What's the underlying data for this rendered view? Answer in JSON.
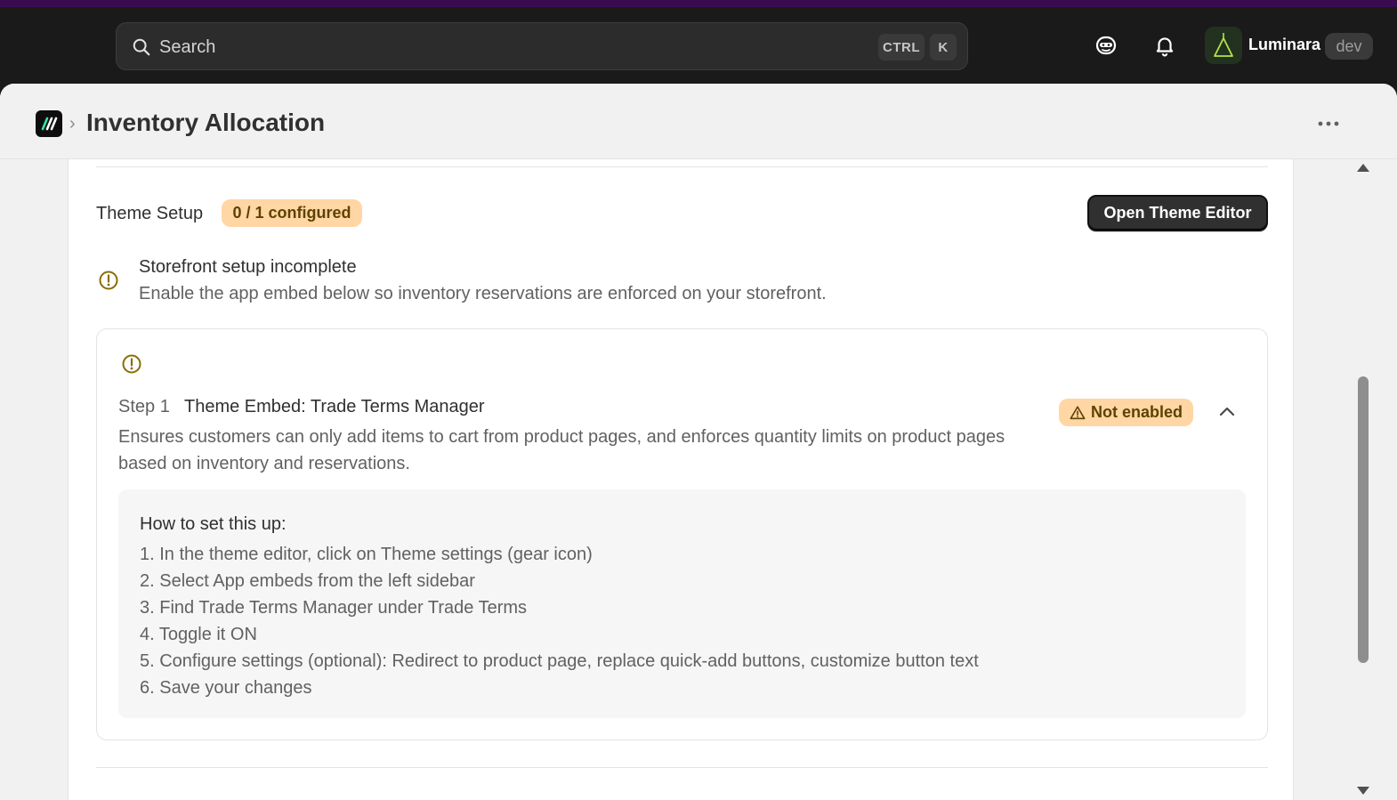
{
  "topbar": {
    "search_placeholder": "Search",
    "shortcut_ctrl": "CTRL",
    "shortcut_k": "K",
    "store_name": "Luminara",
    "store_badge": "dev"
  },
  "page": {
    "title": "Inventory Allocation"
  },
  "theme_setup": {
    "title": "Theme Setup",
    "count_badge": "0 / 1 configured",
    "open_button": "Open Theme Editor",
    "alert_title": "Storefront setup incomplete",
    "alert_desc": "Enable the app embed below so inventory reservations are enforced on your storefront."
  },
  "step": {
    "label": "Step 1",
    "title": "Theme Embed: Trade Terms Manager",
    "description": "Ensures customers can only add items to cart from product pages, and enforces quantity limits on product pages based on inventory and reservations.",
    "status": "Not enabled",
    "howto_title": "How to set this up:",
    "howto_steps": [
      "1. In the theme editor, click on Theme settings (gear icon)",
      "2. Select App embeds from the left sidebar",
      "3. Find Trade Terms Manager under Trade Terms",
      "4. Toggle it ON",
      "5. Configure settings (optional): Redirect to product page, replace quick-add buttons, customize button text",
      "6. Save your changes"
    ]
  },
  "colors": {
    "topbar_bg": "#1a1a1a",
    "accent_strip": "#3b0b4f",
    "warning_badge_bg": "#ffd6a4",
    "warning_icon": "#8a6d00",
    "primary_button": "#303030"
  },
  "icons": {
    "search": "search-icon",
    "assistant": "assistant-icon",
    "bell": "bell-icon",
    "store": "store-logo-icon",
    "app_logo": "app-logo-icon",
    "more": "more-horizontal-icon",
    "alert": "alert-circle-icon",
    "warning": "warning-triangle-icon",
    "collapse": "chevron-up-icon"
  }
}
